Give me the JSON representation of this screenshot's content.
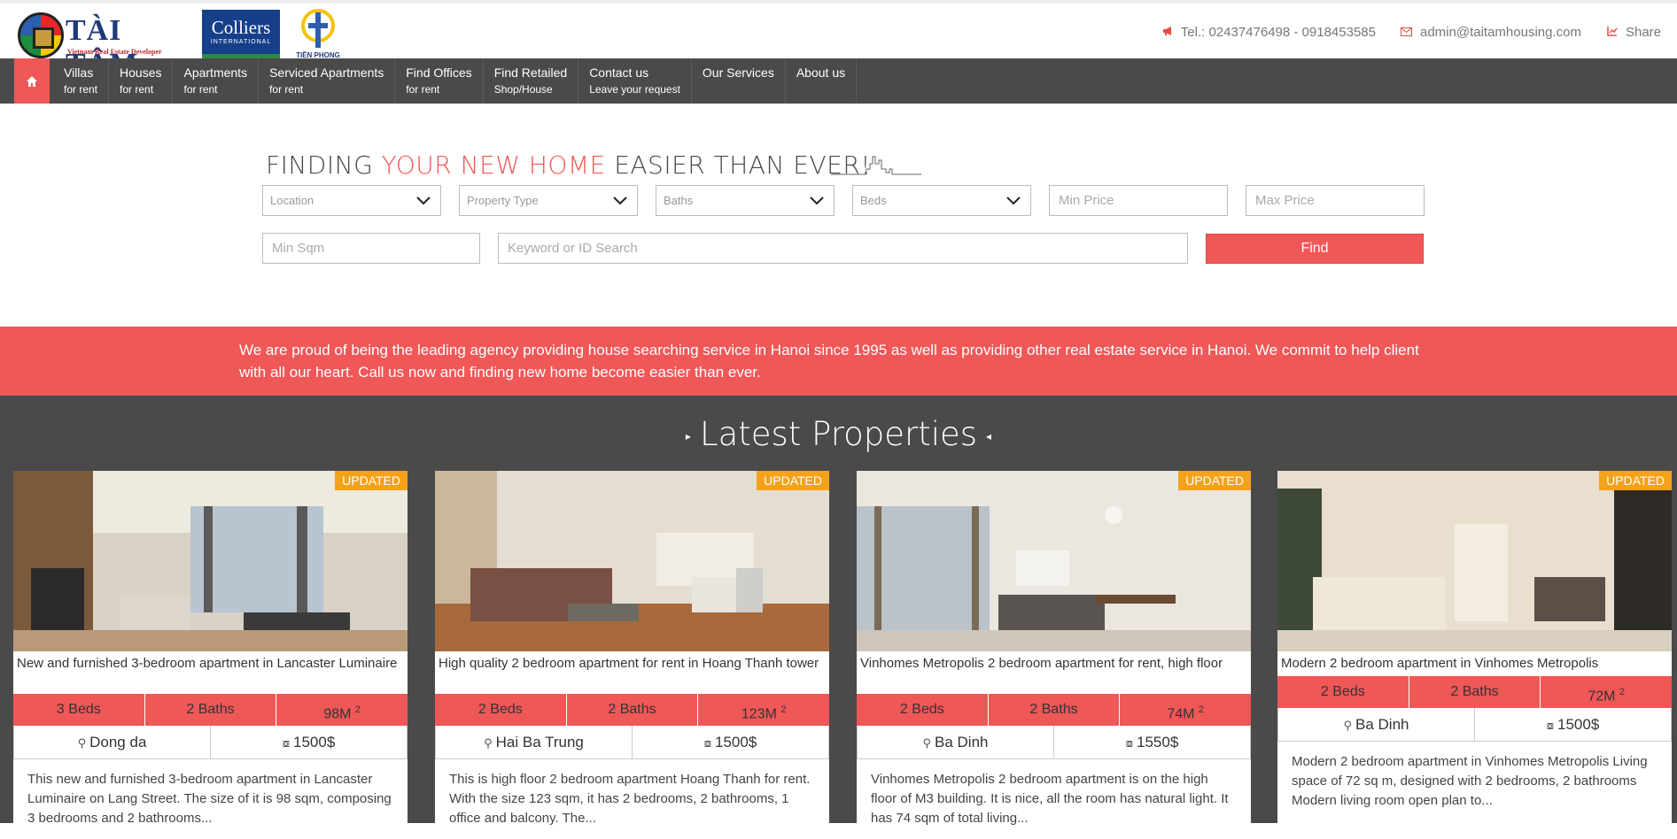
{
  "header": {
    "logo_text": "TÀI TÂM",
    "logo_sub": "Vietnam Real Estate Developer",
    "partner1_name": "Colliers",
    "partner1_sub": "INTERNATIONAL",
    "partner2_name": "TIỀN PHONG",
    "phone": "Tel.: 02437476498 - 0918453585",
    "email": "admin@taitamhousing.com",
    "share": "Share",
    "phone_icon": "megaphone-icon",
    "email_icon": "envelope-icon",
    "share_icon": "share-icon"
  },
  "nav": {
    "home_icon": "home-icon",
    "items": [
      {
        "l1": "Villas",
        "l2": "for rent"
      },
      {
        "l1": "Houses",
        "l2": "for rent"
      },
      {
        "l1": "Apartments",
        "l2": "for rent"
      },
      {
        "l1": "Serviced Apartments",
        "l2": "for rent"
      },
      {
        "l1": "Find Offices",
        "l2": "for rent"
      },
      {
        "l1": "Find Retailed",
        "l2": "Shop/House"
      },
      {
        "l1": "Contact us",
        "l2": "Leave your request"
      },
      {
        "l1": "Our Services",
        "l2": ""
      },
      {
        "l1": "About us",
        "l2": ""
      }
    ]
  },
  "search": {
    "title_a": "FINDING ",
    "title_b": "YOUR NEW HOME",
    "title_c": " EASIER THAN EVER!",
    "location": "Location",
    "property_type": "Property Type",
    "baths": "Baths",
    "beds": "Beds",
    "min_price": "Min Price",
    "max_price": "Max Price",
    "min_sqm": "Min Sqm",
    "keyword": "Keyword or ID Search",
    "find": "Find"
  },
  "banner": "We are proud of being the leading agency providing house searching service in Hanoi since 1995 as well as providing other real estate service in Hanoi. We commit to help client with all our heart. Call us now and finding new home become easier than ever.",
  "latest_title": "Latest Properties",
  "badge": "UPDATED",
  "cards": [
    {
      "title": "New and furnished 3-bedroom apartment in Lancaster Luminaire",
      "beds": "3 Beds",
      "baths": "2 Baths",
      "area": "98M",
      "sup": "2",
      "location": "Dong da",
      "price": "1500$",
      "desc": "This new and furnished 3-bedroom apartment in Lancaster Luminaire on Lang Street. The size of it is 98 sqm, composing 3 bedrooms and 2 bathrooms..."
    },
    {
      "title": "High quality 2 bedroom apartment for rent in Hoang Thanh tower",
      "beds": "2 Beds",
      "baths": "2 Baths",
      "area": "123M",
      "sup": "2",
      "location": "Hai Ba Trung",
      "price": "1500$",
      "desc": "This is high floor 2 bedroom apartment Hoang Thanh for rent. With the size 123 sqm, it has 2 bedrooms, 2 bathrooms, 1 office and balcony. The..."
    },
    {
      "title": "Vinhomes Metropolis 2 bedroom apartment for rent, high floor",
      "beds": "2 Beds",
      "baths": "2 Baths",
      "area": "74M",
      "sup": "2",
      "location": "Ba Dinh",
      "price": "1550$",
      "desc": "Vinhomes Metropolis 2 bedroom apartment is on the high floor of M3 building. It is nice, all the room has natural light. It has 74 sqm of total living..."
    },
    {
      "title": "Modern 2 bedroom apartment in Vinhomes Metropolis",
      "beds": "2 Beds",
      "baths": "2 Baths",
      "area": "72M",
      "sup": "2",
      "location": "Ba Dinh",
      "price": "1500$",
      "desc": "Modern 2 bedroom apartment in Vinhomes Metropolis Living space of 72 sq m, designed with 2 bedrooms, 2 bathrooms Modern living room open plan to..."
    }
  ],
  "icons": {
    "location": "map-pin-icon",
    "price": "money-icon",
    "dropdown": "chevron-down-icon"
  },
  "colors": {
    "accent": "#f05757",
    "nav_bg": "#4a4a4a",
    "badge": "#f5a21b"
  }
}
